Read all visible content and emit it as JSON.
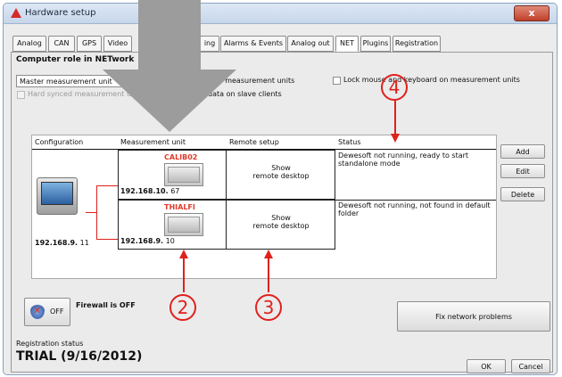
{
  "window": {
    "title": "Hardware setup",
    "close_label": "x"
  },
  "tabs": [
    {
      "label": "Analog",
      "active": false
    },
    {
      "label": "CAN",
      "active": false
    },
    {
      "label": "GPS",
      "active": false
    },
    {
      "label": "Video",
      "active": false
    },
    {
      "label": "ing",
      "active": false
    },
    {
      "label": "Alarms & Events",
      "active": false
    },
    {
      "label": "Analog out",
      "active": false
    },
    {
      "label": "NET",
      "active": true
    },
    {
      "label": "Plugins",
      "active": false
    },
    {
      "label": "Registration",
      "active": false
    }
  ],
  "net": {
    "role_heading": "Computer role in NETwork",
    "role_value": "Master measurement unit",
    "hard_synced_label": "Hard synced measurement unit",
    "option_units_label": "s on measurement units",
    "option_slave_label": "data on slave clients",
    "lock_label": "Lock mouse and keyboard on measurement units"
  },
  "table": {
    "headers": [
      "Configuration",
      "Measurement unit",
      "Remote setup",
      "Status"
    ],
    "config_ip_bold": "192.168.9.",
    "config_ip_rest": " 11",
    "rows": [
      {
        "unit_name": "CALIB02",
        "ip_bold": "192.168.10.",
        "ip_rest": " 67",
        "remote": "Show\nremote desktop",
        "status": "Dewesoft not running, ready to start standalone mode"
      },
      {
        "unit_name": "THIALFI",
        "ip_bold": "192.168.9.",
        "ip_rest": " 10",
        "remote": "Show\nremote desktop",
        "status": "Dewesoft not running, not found in default folder"
      }
    ]
  },
  "buttons": {
    "add": "Add",
    "edit": "Edit",
    "delete": "Delete",
    "firewall_off": "OFF",
    "fix_network": "Fix network problems",
    "ok": "OK",
    "cancel": "Cancel"
  },
  "firewall": {
    "label": "Firewall is OFF"
  },
  "registration": {
    "label": "Registration status",
    "value": "TRIAL (9/16/2012)"
  },
  "annotations": [
    "2",
    "3",
    "4"
  ],
  "colors": {
    "annotation_red": "#e0201c",
    "unit_name_red": "#e03b2a",
    "overlay_arrow_gray": "#9c9c9c"
  },
  "icons": {
    "app": "dewesoft-triangle-icon",
    "firewall": "shield-icon",
    "device": "monitor-icon"
  }
}
